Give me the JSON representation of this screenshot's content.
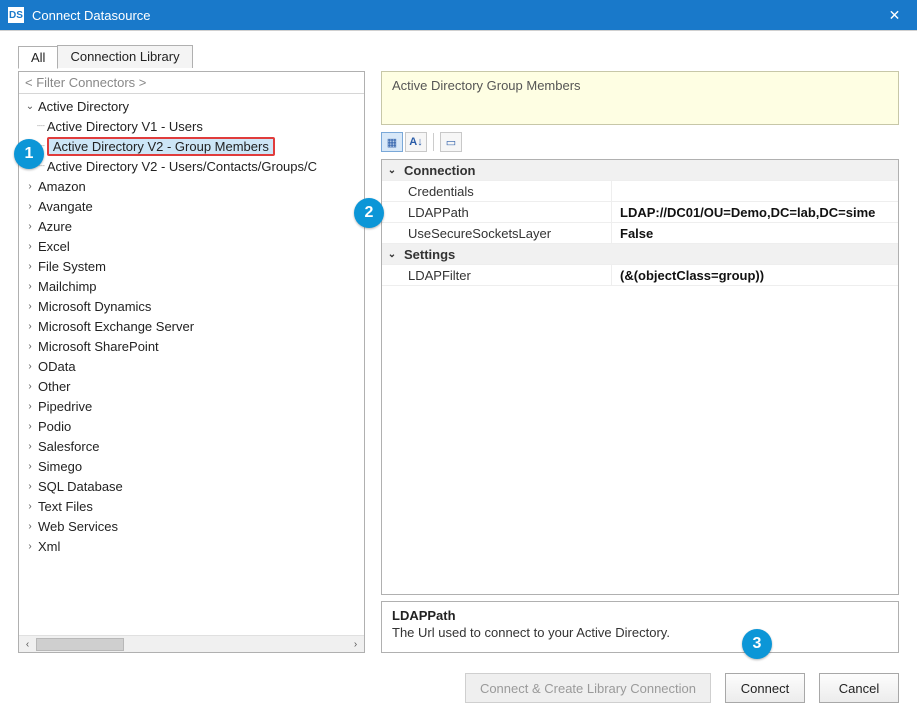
{
  "window": {
    "title": "Connect Datasource",
    "app_icon_text": "DS"
  },
  "tabs": {
    "all": "All",
    "library": "Connection Library"
  },
  "filter_placeholder": "< Filter Connectors >",
  "tree": {
    "root": "Active Directory",
    "children": [
      "Active Directory V1 - Users",
      "Active Directory V2 - Group Members",
      "Active Directory V2 - Users/Contacts/Groups/C"
    ],
    "siblings": [
      "Amazon",
      "Avangate",
      "Azure",
      "Excel",
      "File System",
      "Mailchimp",
      "Microsoft Dynamics",
      "Microsoft Exchange Server",
      "Microsoft SharePoint",
      "OData",
      "Other",
      "Pipedrive",
      "Podio",
      "Salesforce",
      "Simego",
      "SQL Database",
      "Text Files",
      "Web Services",
      "Xml"
    ]
  },
  "right_header": "Active Directory Group Members",
  "propgrid": {
    "cat_connection": "Connection",
    "credentials_k": "Credentials",
    "credentials_v": "",
    "ldappath_k": "LDAPPath",
    "ldappath_v": "LDAP://DC01/OU=Demo,DC=lab,DC=sime",
    "usessl_k": "UseSecureSocketsLayer",
    "usessl_v": "False",
    "cat_settings": "Settings",
    "ldapfilter_k": "LDAPFilter",
    "ldapfilter_v": "(&(objectClass=group))"
  },
  "desc": {
    "title": "LDAPPath",
    "text": "The Url used to connect to your Active Directory."
  },
  "buttons": {
    "createlib": "Connect & Create Library Connection",
    "connect": "Connect",
    "cancel": "Cancel"
  },
  "badges": {
    "b1": "1",
    "b2": "2",
    "b3": "3"
  }
}
